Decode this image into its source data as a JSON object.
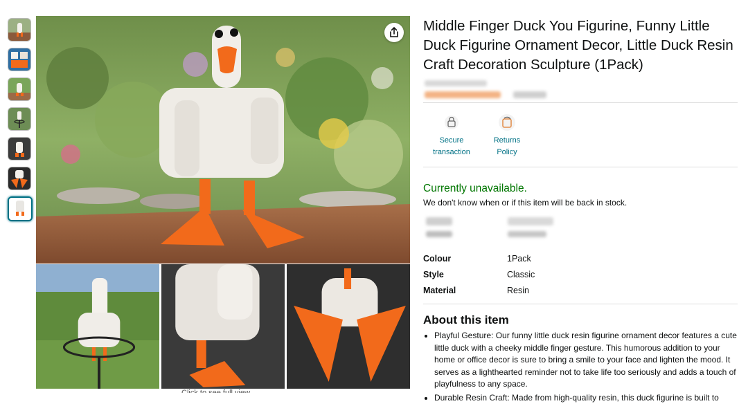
{
  "product": {
    "title": "Middle Finger Duck You Figurine, Funny Little Duck Figurine Ornament Decor, Little Duck Resin Craft Decoration Sculpture (1Pack)"
  },
  "badges": [
    {
      "icon": "lock-icon",
      "label": "Secure transaction"
    },
    {
      "icon": "returns-icon",
      "label": "Returns Policy"
    }
  ],
  "availability": {
    "status": "Currently unavailable.",
    "note": "We don't know when or if this item will be back in stock."
  },
  "specs": [
    {
      "key": "Colour",
      "value": "1Pack"
    },
    {
      "key": "Style",
      "value": "Classic"
    },
    {
      "key": "Material",
      "value": "Resin"
    }
  ],
  "about": {
    "heading": "About this item",
    "bullets": [
      "Playful Gesture: Our funny little duck resin figurine ornament decor features a cute little duck with a cheeky middle finger gesture. This humorous addition to your home or office decor is sure to bring a smile to your face and lighten the mood. It serves as a lighthearted reminder not to take life too seriously and adds a touch of playfulness to any space.",
      "Durable Resin Craft: Made from high-quality resin, this duck figurine is built to"
    ]
  },
  "gallery": {
    "caption": "Click to see full view"
  },
  "colors": {
    "link": "#007185",
    "available": "#007600",
    "duck_orange": "#f26a1b"
  }
}
